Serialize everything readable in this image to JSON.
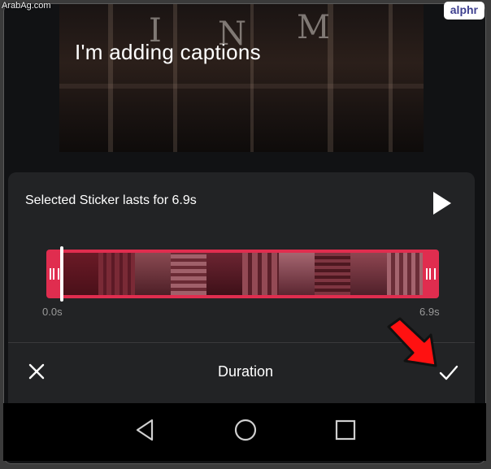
{
  "watermark": "ArabAg.com",
  "brand": "alphr",
  "video": {
    "caption": "I'm adding captions"
  },
  "sticker": {
    "lasts_text": "Selected Sticker lasts for 6.9s"
  },
  "timeline": {
    "start_label": "0.0s",
    "end_label": "6.9s",
    "accent": "#e02d4f"
  },
  "bottom_bar": {
    "title": "Duration"
  },
  "icons": [
    "play-icon",
    "close-icon",
    "check-icon",
    "back-icon",
    "home-icon",
    "recents-icon",
    "red-arrow-icon"
  ]
}
